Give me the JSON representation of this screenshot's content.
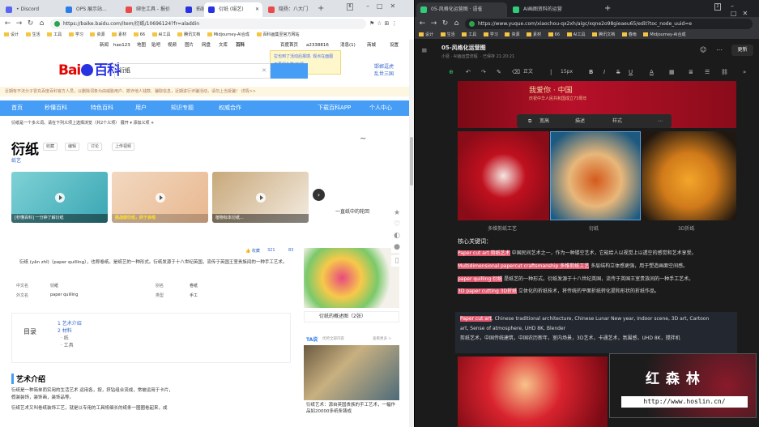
{
  "left_browser": {
    "tabs": [
      {
        "label": "• Discord",
        "color": "#5865f2"
      },
      {
        "label": "OPS 展示站...",
        "color": "#2b7de9"
      },
      {
        "label": "绑住工具 - 报价",
        "color": "#e94b4b"
      },
      {
        "label": "拓纸 (百度搜索",
        "color": "#2932e1"
      },
      {
        "label": "衍纸 (绢艺)",
        "color": "#2932e1"
      },
      {
        "label": "隐扬：八大门",
        "color": "#e94b4b"
      }
    ],
    "new_tab": "+",
    "url": "https://baike.baidu.com/item/衍纸/10696124?fr=aladdin",
    "bookmarks": [
      "设计",
      "生活",
      "工具",
      "学习",
      "资源",
      "素材",
      "66",
      "AI工具",
      "腾讯文档",
      "Midjourney-AI合成",
      "百科画集至官方网站"
    ],
    "top_nav": [
      "新闻",
      "hao123",
      "地图",
      "贴吧",
      "视频",
      "图片",
      "网盘",
      "文库",
      "百科",
      "百度首页",
      "a2338816",
      "消息(1)",
      "商城",
      "设置"
    ],
    "popup": {
      "line1": "拉也到了活动后报感. 观点在面图",
      "line2": "不再得色数(7)题"
    },
    "logo": {
      "bai": "Bai",
      "du": "百科"
    },
    "search_value": "衍纸",
    "search_side": {
      "line1": "邯郸逗虎",
      "line2": "乱世三国"
    },
    "notice": "近期有不法分子冒充百度百科官方人员，以删除词条为由威胁用户、欺诈他人钱款、骗取信息，近期进行诈骗活动，请勿上当受骗！ 详情>>",
    "nav": [
      "首页",
      "秒懂百科",
      "特色百科",
      "用户",
      "知识专题",
      "权威合作",
      "下载百科APP",
      "个人中心"
    ],
    "crumb": "衍纸是一个多义词。请在下列义项上选择浏览（共2个义项）     展开 ▾          添加义项 +",
    "title": "衍纸",
    "subtitle": "纸艺",
    "actions": [
      "收藏",
      "编辑",
      "讨论",
      "上传视频"
    ],
    "videos": [
      {
        "cap": "[秒懂百科] 一分钟了解衍纸",
        "time": "00:57"
      },
      {
        "cap": "挑战做衍纸，终于会啦",
        "time": ""
      },
      {
        "cap": "植物标本衍纸...",
        "time": "02:13"
      },
      {
        "cap": "一直纸中的轮回",
        "time": ""
      }
    ],
    "stats": {
      "like": "收藏",
      "count1": "321",
      "count2": "83"
    },
    "intro": "衍纸 (yǎn zhǐ)（paper quilling），也称卷纸。是纸艺的一种形式。衍纸发源于十八世纪英国，流传于英国王室贵族间的一种手工艺术。",
    "infobox": [
      [
        "中文名",
        "衍纸",
        "别名",
        "卷纸"
      ],
      [
        "外文名",
        "paper quilling",
        "类型",
        "手工"
      ]
    ],
    "toc": {
      "title": "目录",
      "items": [
        "1 艺术介绍",
        "2 材料",
        "  · 纸",
        "  · 工具"
      ]
    },
    "section": {
      "title": "艺术介绍",
      "p1": "衍纸是一种简单而实用的生活艺术 运用各，按，挤钻组合流成，常被运用于卡片，",
      "p2": "假装装饰，装饰画，装饰品等。",
      "p3": "衍纸艺术又叫卷纸装饰工艺，就是以专用的工具将细长的纸条一圈圈卷起来，成"
    },
    "gallery": {
      "caption": "衍纸的概述图（2张）"
    },
    "ad": {
      "brand": "TA说",
      "link": "优势全部内容",
      "more": "查看更多 >",
      "caption": "衍纸艺术：源自英国贵族的手工艺术，一幅作品如20000多纸条铸成"
    }
  },
  "right_browser": {
    "tabs": [
      {
        "label": "05-风格化运营图 · 语雀"
      },
      {
        "label": "AI画图资料的运营"
      }
    ],
    "url": "https://www.yuque.com/xiaochou-qx2xh/aigc/xqne2o98gieaeu65/edit?toc_node_uuid=e",
    "bookmarks": [
      "设计",
      "生活",
      "工具",
      "学习",
      "资源",
      "素材",
      "66",
      "AI工具",
      "腾讯文档",
      "春雨",
      "Midjourney-AI合成",
      "百科画集至官方网站"
    ],
    "doc_title": "05-风格化运营图",
    "meta": "小竖 · AI画运营流程  · 已保存 21:20:21",
    "update_btn": "更新",
    "toolbar": {
      "style": "正文",
      "size": "15px"
    },
    "imgtool": [
      "宽高",
      "描述",
      "样式"
    ],
    "banner_text": "我爱你 · 中国",
    "banner_sub": "庆祝中华人民共和国成立73周年",
    "captions": [
      "多维剪纸工艺",
      "衍纸",
      "3D折纸"
    ],
    "keywords_title": "核心关键词：",
    "keywords": [
      {
        "hl": "Paper cut art 剪纸艺术",
        "rest": " 中国民间艺术之一，作为一种镂空艺术，它能给人以视觉上以透空的感觉和艺术享受。"
      },
      {
        "hl": "Multidimensional papercut craftsmanship 多维剪纸工艺",
        "rest": " 多层结构立体感更强，用于塑造画面空间感。"
      },
      {
        "hl": "paper quilling 衍纸",
        "rest": " 是纸艺的一种形式。衍纸发源于十八世纪英国，流传于英国王室贵族间的一种手工艺术。"
      },
      {
        "hl": "3D paper cutting 3D折纸",
        "rest": " 立体化的折纸技术，将传统的平面折纸转化提和形状的折纸作品。"
      }
    ],
    "code": {
      "l1_hl": "Paper cut art",
      "l1": ", Chinese traditional architecture, Chinese Lunar New year, Indoor scene, 3D art, Cartoon",
      "l2": "art, Sense of atmosphere, UHD 8K, Blender",
      "l3": "剪纸艺术，中国传统建筑，中国农历新年，室内场景，3D艺术，卡通艺术，氛围感，UHD 8K，搅拌机"
    },
    "watermark": {
      "cn": "红 森 林",
      "url": "http://www.hoslin.cn/"
    }
  }
}
